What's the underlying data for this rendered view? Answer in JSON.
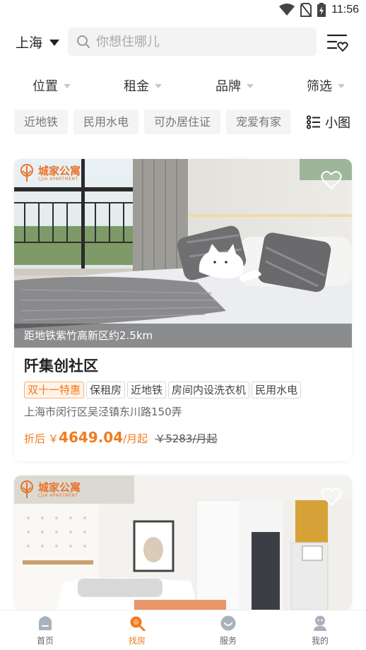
{
  "status": {
    "time": "11:56"
  },
  "header": {
    "city": "上海",
    "search_placeholder": "你想住哪儿"
  },
  "filters": [
    {
      "label": "位置"
    },
    {
      "label": "租金"
    },
    {
      "label": "品牌"
    },
    {
      "label": "筛选"
    }
  ],
  "tags": [
    "近地铁",
    "民用水电",
    "可办居住证",
    "宠爱有家"
  ],
  "view_toggle": {
    "label": "小图"
  },
  "listings": [
    {
      "brand_name": "城家公寓",
      "brand_sub": "CJIA APARTMENT",
      "distance": "距地铁紫竹高新区约2.5km",
      "title": "阡集创社区",
      "badges": [
        "双十一特惠",
        "保租房",
        "近地铁",
        "房间内设洗衣机",
        "民用水电"
      ],
      "address": "上海市闵行区吴泾镇东川路150弄",
      "price_prefix": "折后",
      "currency": "￥",
      "price": "4649.04",
      "price_unit": "/月起",
      "original_price": "￥5283/月起"
    },
    {
      "brand_name": "城家公寓",
      "brand_sub": "CJIA APARTMENT"
    }
  ],
  "bottom_nav": [
    {
      "label": "首页",
      "icon": "home-icon"
    },
    {
      "label": "找房",
      "icon": "search-house-icon"
    },
    {
      "label": "服务",
      "icon": "service-icon"
    },
    {
      "label": "我的",
      "icon": "profile-icon"
    }
  ],
  "colors": {
    "accent": "#f07b1e",
    "brand": "#e8732a"
  }
}
